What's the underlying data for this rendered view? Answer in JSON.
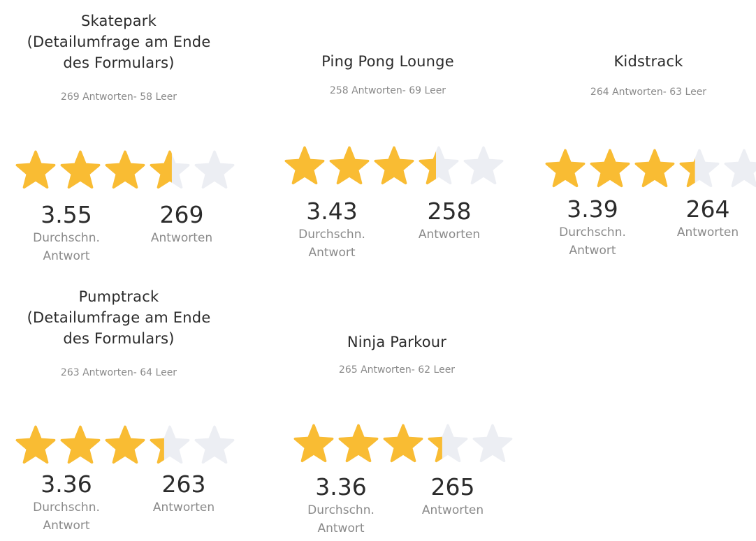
{
  "colors": {
    "star_filled": "#F9BC33",
    "star_empty": "#ECEEF3",
    "title": "#2B2B2B",
    "muted": "#8A8A8A"
  },
  "cards": [
    {
      "title": "Skatepark\n(Detailumfrage am Ende\ndes Formulars)",
      "summary": "269 Antworten- 58 Leer",
      "rating": 3.55,
      "avg_value": "3.55",
      "avg_label": "Durchschn.\nAntwort",
      "count_value": "269",
      "count_label": "Antworten",
      "star_icon": "star-icon"
    },
    {
      "title": "Ping Pong Lounge",
      "summary": "258 Antworten- 69 Leer",
      "rating": 3.43,
      "avg_value": "3.43",
      "avg_label": "Durchschn.\nAntwort",
      "count_value": "258",
      "count_label": "Antworten",
      "star_icon": "star-icon"
    },
    {
      "title": "Kidstrack",
      "summary": "264 Antworten- 63 Leer",
      "rating": 3.39,
      "avg_value": "3.39",
      "avg_label": "Durchschn.\nAntwort",
      "count_value": "264",
      "count_label": "Antworten",
      "star_icon": "star-icon"
    },
    {
      "title": "Pumptrack\n(Detailumfrage am Ende\ndes Formulars)",
      "summary": "263 Antworten- 64 Leer",
      "rating": 3.36,
      "avg_value": "3.36",
      "avg_label": "Durchschn.\nAntwort",
      "count_value": "263",
      "count_label": "Antworten",
      "star_icon": "star-icon"
    },
    {
      "title": "Ninja Parkour",
      "summary": "265 Antworten- 62 Leer",
      "rating": 3.36,
      "avg_value": "3.36",
      "avg_label": "Durchschn.\nAntwort",
      "count_value": "265",
      "count_label": "Antworten",
      "star_icon": "star-icon"
    }
  ]
}
